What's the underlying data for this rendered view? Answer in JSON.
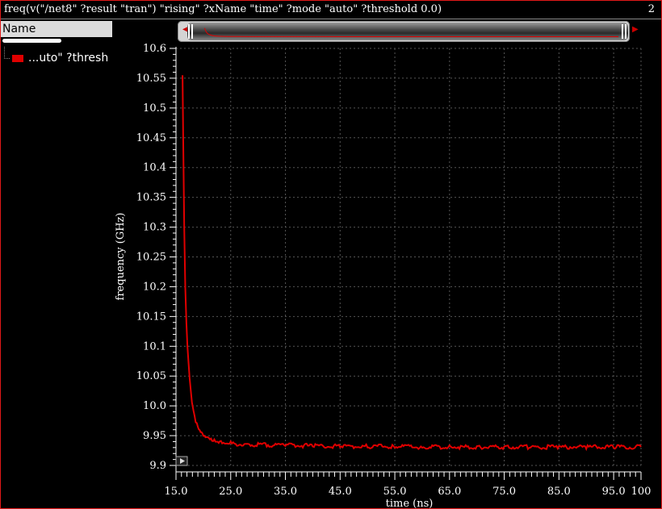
{
  "window": {
    "title": "freq(v(\"/net8\" ?result \"tran\") \"rising\" ?xName \"time\" ?mode \"auto\" ?threshold 0.0)",
    "subwindow_number": "2"
  },
  "legend": {
    "header": "Name",
    "items": [
      {
        "label": "...uto\" ?thresh",
        "color": "#e00000"
      }
    ]
  },
  "colors": {
    "trace": "#e00000",
    "grid": "#555555",
    "axis": "#ffffff",
    "background": "#000000"
  },
  "icons": {
    "scroll_left": "left-arrow-icon",
    "scroll_right": "right-arrow-icon",
    "marker": "play-marker-icon"
  },
  "chart_data": {
    "type": "line",
    "title": "",
    "xlabel": "time (ns)",
    "ylabel": "frequency (GHz)",
    "xlim": [
      15.0,
      100.0
    ],
    "ylim": [
      9.9,
      10.6
    ],
    "xticks": [
      15,
      25,
      35,
      45,
      55,
      65,
      75,
      85,
      95,
      100
    ],
    "xtick_labels": [
      "15.0",
      "25.0",
      "35.0",
      "45.0",
      "55.0",
      "65.0",
      "75.0",
      "85.0",
      "95.0",
      "100"
    ],
    "yticks": [
      9.9,
      9.95,
      10.0,
      10.05,
      10.1,
      10.15,
      10.2,
      10.25,
      10.3,
      10.35,
      10.4,
      10.45,
      10.5,
      10.55,
      10.6
    ],
    "ytick_labels": [
      "9.9",
      "9.95",
      "10.0",
      "10.05",
      "10.1",
      "10.15",
      "10.2",
      "10.25",
      "10.3",
      "10.35",
      "10.4",
      "10.45",
      "10.5",
      "10.55",
      "10.6"
    ],
    "grid": true,
    "series": [
      {
        "color": "#e00000",
        "x": [
          16.2,
          16.35,
          16.5,
          16.7,
          16.9,
          17.1,
          17.3,
          17.5,
          17.7,
          17.9,
          18.2,
          18.6,
          19.0,
          19.5,
          20.0,
          21.0,
          22.0,
          23.0,
          25.0,
          27.5,
          30.0,
          35.0,
          40.0,
          45.0,
          50.0,
          55.0,
          60.0,
          65.0,
          70.0,
          75.0,
          80.0,
          85.0,
          90.0,
          95.0,
          100.0
        ],
        "y": [
          10.555,
          10.43,
          10.3,
          10.2,
          10.14,
          10.1,
          10.07,
          10.045,
          10.025,
          10.005,
          9.99,
          9.975,
          9.965,
          9.958,
          9.952,
          9.947,
          9.943,
          9.94,
          9.937,
          9.935,
          9.935,
          9.934,
          9.933,
          9.932,
          9.932,
          9.932,
          9.931,
          9.931,
          9.931,
          9.931,
          9.931,
          9.931,
          9.931,
          9.931,
          9.931
        ]
      }
    ]
  }
}
